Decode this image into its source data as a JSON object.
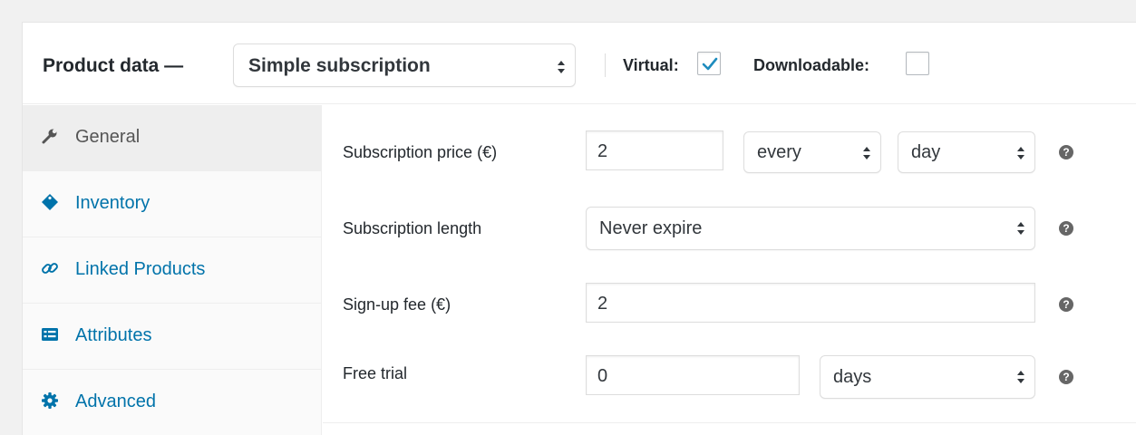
{
  "header": {
    "title": "Product data —",
    "product_type": "Simple subscription",
    "virtual_label": "Virtual:",
    "virtual_checked": true,
    "downloadable_label": "Downloadable:",
    "downloadable_checked": false
  },
  "sidebar": {
    "items": [
      {
        "label": "General",
        "icon": "wrench-icon",
        "active": true
      },
      {
        "label": "Inventory",
        "icon": "tag-icon",
        "active": false
      },
      {
        "label": "Linked Products",
        "icon": "link-icon",
        "active": false
      },
      {
        "label": "Attributes",
        "icon": "list-icon",
        "active": false
      },
      {
        "label": "Advanced",
        "icon": "gear-icon",
        "active": false
      }
    ]
  },
  "form": {
    "price": {
      "label": "Subscription price (€)",
      "value": "2",
      "interval": "every",
      "period": "day"
    },
    "length": {
      "label": "Subscription length",
      "value": "Never expire"
    },
    "signup": {
      "label": "Sign-up fee (€)",
      "value": "2"
    },
    "trial": {
      "label": "Free trial",
      "value": "0",
      "period": "days"
    },
    "help_glyph": "?"
  },
  "colors": {
    "link": "#0073aa",
    "active_tab_bg": "#eeeeee",
    "check": "#1e8cbe"
  }
}
